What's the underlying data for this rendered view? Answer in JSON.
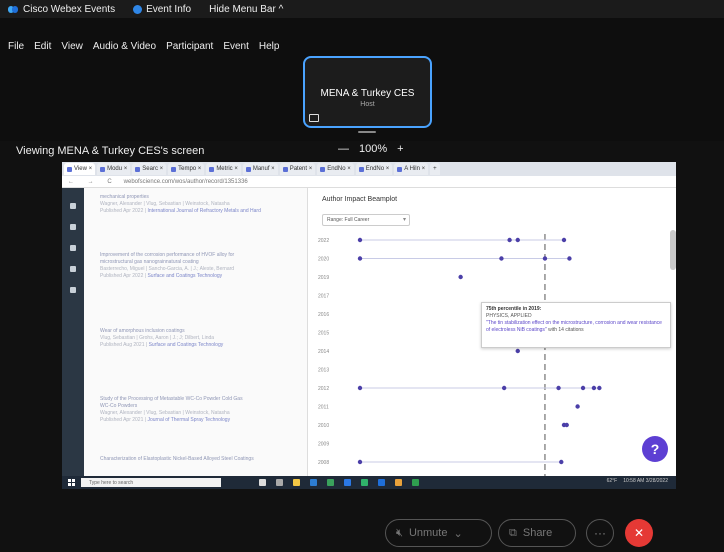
{
  "topbar": {
    "app_title": "Cisco Webex Events",
    "event_info": "Event Info",
    "hide_menu": "Hide Menu Bar ^"
  },
  "menu": [
    "File",
    "Edit",
    "View",
    "Audio & Video",
    "Participant",
    "Event",
    "Help"
  ],
  "host_tile": {
    "name": "MENA & Turkey CES",
    "role": "Host"
  },
  "viewing_label": "Viewing MENA & Turkey CES's screen",
  "zoom": {
    "minus": "—",
    "level": "100%",
    "plus": "+"
  },
  "browser": {
    "tabs": [
      "View ×",
      "Modu ×",
      "Searc ×",
      "Tempo ×",
      "Metric ×",
      "Manuf ×",
      "Patent ×",
      "EndNo ×",
      "EndNo ×",
      "A Hiln ×",
      "+"
    ],
    "nav": "← → C",
    "url": "webofscience.com/wos/author/record/1351336"
  },
  "publications": [
    {
      "title": "mechanical properties",
      "authors": "Wagner, Alexander | Vlug, Sebastian | Weinstock, Natasha",
      "meta": "Published Apr 2022 |",
      "journal": "International Journal of Refractory Metals and Hard"
    },
    {
      "title": "Improvement of the corrosion performance of HVOF alloy for",
      "title2": "microstructural gas nanograinnatural coating",
      "authors": "Basterrecho, Miguel | Sancho-Garcia, A. | J.; Aleste, Bernard",
      "meta": "Published Apr 2022 |",
      "journal": "Surface and Coatings Technology"
    },
    {
      "title": "Wear of amorphous inclusion coatings",
      "authors": "Vlug, Sebastian | Grohs, Aaron | J.; J; Dilbert, Linda",
      "meta": "Published Aug 2021 |",
      "journal": "Surface and Coatings Technology"
    },
    {
      "title": "Study of the Processing of Metastable WC-Co Powder Cold Gas",
      "title2": "WC-Co Powders",
      "authors": "Wagner, Alexander | Vlug, Sebastian | Weinstock, Natasha",
      "meta": "Published Apr 2021 |",
      "journal": "Journal of Thermal Spray Technology"
    },
    {
      "title": "Characterization of Elastoplastic Nickel-Based Alloyed Steel Coatings",
      "authors": "",
      "meta": "",
      "journal": ""
    }
  ],
  "modal": {
    "title": "Author Impact Beamplot",
    "range_label": "Range: Full Career"
  },
  "chart_data": {
    "type": "scatter",
    "title": "",
    "xlabel": "",
    "ylabel": "",
    "y_categories": [
      "2022",
      "2020",
      "2019",
      "2017",
      "2016",
      "2015",
      "2014",
      "2013",
      "2012",
      "2011",
      "2010",
      "2009",
      "2008"
    ],
    "median_reference": 0.68,
    "series": [
      {
        "values": [
          {
            "y": "2022",
            "x": [
              0.0,
              0.55,
              0.58,
              0.75
            ]
          },
          {
            "y": "2020",
            "x": [
              0.0,
              0.52,
              0.68,
              0.77
            ]
          },
          {
            "y": "2019",
            "x": [
              0.37
            ]
          },
          {
            "y": "2016",
            "x": [
              0.6,
              0.72,
              0.79
            ]
          },
          {
            "y": "2015",
            "x": [
              0.61
            ]
          },
          {
            "y": "2014",
            "x": [
              0.58
            ]
          },
          {
            "y": "2012",
            "x": [
              0.0,
              0.53,
              0.73,
              0.82,
              0.86,
              0.88
            ]
          },
          {
            "y": "2011",
            "x": [
              0.8
            ]
          },
          {
            "y": "2010",
            "x": [
              0.75,
              0.76
            ]
          },
          {
            "y": "2008",
            "x": [
              0.0,
              0.74
            ]
          }
        ]
      }
    ]
  },
  "tooltip": {
    "heading": "75th percentile in 2019:",
    "sub": "PHYSICS, APPLIED",
    "quote": "\"The tin stabilization effect on the microstructure, corrosion and wear resistance of electroless NiB coatings\"",
    "suffix": "with 14 citations"
  },
  "help_label": "?",
  "taskbar": {
    "search_placeholder": "Type here to search",
    "weather": "62°F",
    "time": "10:58 AM",
    "date": "3/28/2022"
  },
  "controls": {
    "unmute": "Unmute",
    "share": "Share",
    "more": "···",
    "leave": "✕"
  }
}
